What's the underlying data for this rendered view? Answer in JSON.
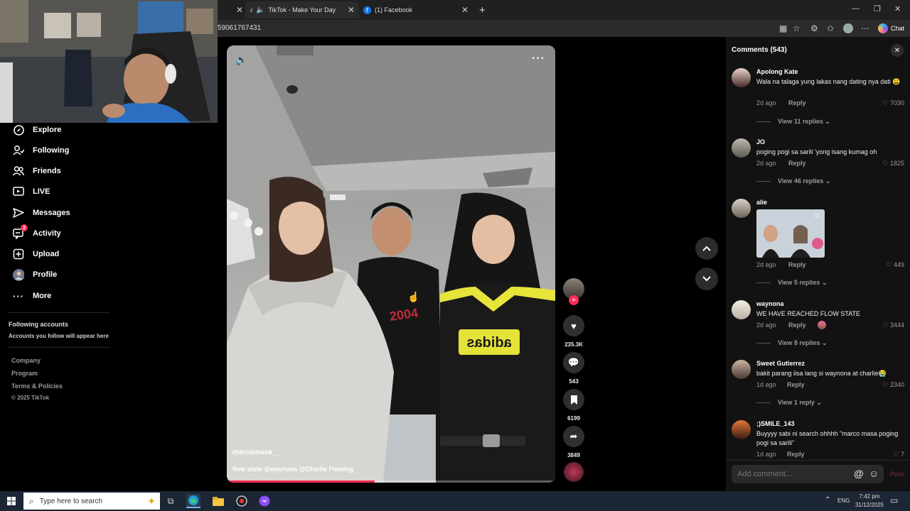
{
  "browser": {
    "tabs": [
      {
        "title": "TikTok - Make Your Day",
        "icon": "tiktok-icon"
      },
      {
        "title": "(1) Facebook",
        "icon": "facebook-icon"
      }
    ],
    "url_fragment": "59061767431",
    "chat_label": "Chat"
  },
  "sidebar": {
    "items": [
      {
        "label": "Explore",
        "icon": "compass-icon"
      },
      {
        "label": "Following",
        "icon": "person-follow-icon"
      },
      {
        "label": "Friends",
        "icon": "friends-icon"
      },
      {
        "label": "LIVE",
        "icon": "live-icon"
      },
      {
        "label": "Messages",
        "icon": "messages-icon"
      },
      {
        "label": "Activity",
        "icon": "activity-icon",
        "badge": "2"
      },
      {
        "label": "Upload",
        "icon": "upload-icon"
      },
      {
        "label": "Profile",
        "icon": "profile-avatar"
      },
      {
        "label": "More",
        "icon": "more-icon"
      }
    ],
    "following_accounts_title": "Following accounts",
    "following_accounts_hint": "Accounts you follow will appear here",
    "footer": [
      "Company",
      "Program",
      "Terms & Policies",
      "© 2025 TikTok"
    ]
  },
  "video": {
    "author": "marcomasa__",
    "caption": "flow state @waynona @Charlie Fleming",
    "progress": 0.45,
    "stats": {
      "likes": "235.3K",
      "comments": "543",
      "saves": "6199",
      "shares": "3849"
    },
    "shirt_text": "adidas"
  },
  "comments": {
    "title": "Comments (543)",
    "items": [
      {
        "user": "Apolong Kate",
        "text": "Wala na talaga yung lakas nang dating nya dati 😩",
        "time": "2d ago",
        "likes": "7030",
        "replies": "View 11 replies"
      },
      {
        "user": "JO",
        "text": "poging pogi sa sarili 'yong isang kumag oh",
        "time": "2d ago",
        "likes": "1825",
        "replies": "View 46 replies"
      },
      {
        "user": "alie",
        "text": "",
        "time": "2d ago",
        "likes": "449",
        "replies": "View 5 replies"
      },
      {
        "user": "waynona",
        "text": "WE HAVE REACHED FLOW STATE",
        "time": "2d ago",
        "likes": "3444",
        "replies": "View 8 replies"
      },
      {
        "user": "Sweet Gutierrez",
        "text": "bakit parang iisa lang si waynona at charlie😭",
        "time": "1d ago",
        "likes": "2340",
        "replies": "View 1 reply"
      },
      {
        "user": ";)SMILE_143",
        "text": "Buyyyy sabi ni search ohhhh \"marco masa poging pogi sa sarili\"",
        "time": "1d ago",
        "likes": "7",
        "replies": ""
      }
    ],
    "reply_label": "Reply",
    "input_placeholder": "Add comment...",
    "post_label": "Post"
  },
  "taskbar": {
    "search_placeholder": "Type here to search",
    "lang": "ENG",
    "time": "7:42 pm",
    "date": "31/12/2025"
  }
}
